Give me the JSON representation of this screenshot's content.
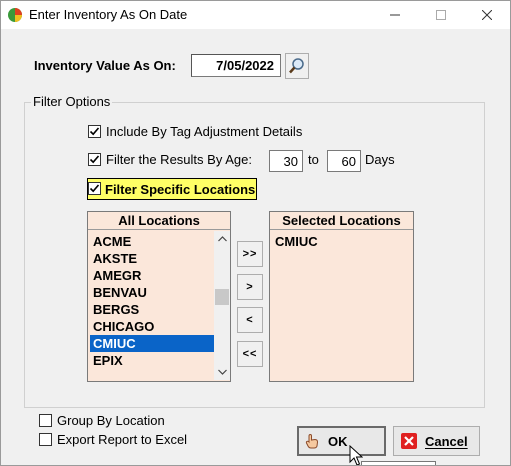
{
  "window": {
    "title": "Enter Inventory As On Date"
  },
  "inventory": {
    "label": "Inventory Value As On:",
    "date": "7/05/2022"
  },
  "filter": {
    "group_label": "Filter Options",
    "include_tag": {
      "label": "Include By Tag Adjustment Details",
      "checked": true
    },
    "filter_age": {
      "label": "Filter the Results By Age:",
      "checked": true,
      "from": "30",
      "to_label": "to",
      "to": "60",
      "unit": "Days"
    },
    "specific_locations": {
      "label": "Filter Specific Locations",
      "checked": true
    }
  },
  "all_locations": {
    "header": "All Locations",
    "items": [
      "ACME",
      "AKSTE",
      "AMEGR",
      "BENVAU",
      "BERGS",
      "CHICAGO",
      "CMIUC",
      "EPIX"
    ],
    "selected": "CMIUC"
  },
  "selected_locations": {
    "header": "Selected Locations",
    "items": [
      "CMIUC"
    ]
  },
  "move_buttons": {
    "add_all": ">>",
    "add": ">",
    "remove": "<",
    "remove_all": "<<"
  },
  "options": {
    "group_by_location": {
      "label": "Group By Location",
      "checked": false
    },
    "export_excel": {
      "label": "Export Report to Excel",
      "checked": false
    }
  },
  "buttons": {
    "ok": "OK",
    "cancel": "Cancel"
  },
  "colors": {
    "list_bg": "#fbe7da",
    "highlight": "#ffff66",
    "selection": "#0a64c8",
    "cancel_icon": "#e02020"
  }
}
